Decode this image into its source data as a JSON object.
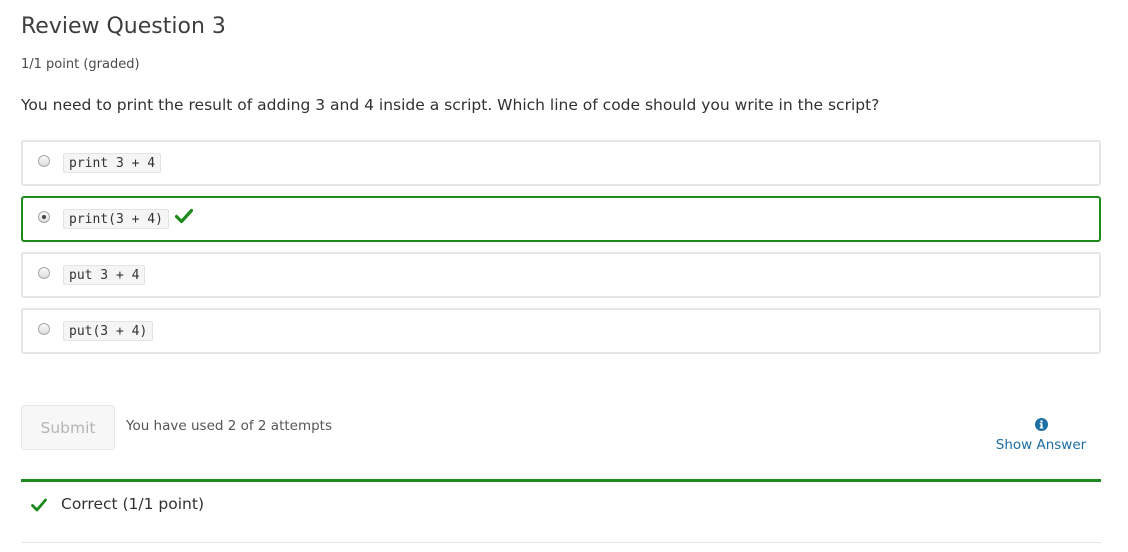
{
  "problem": {
    "title": "Review Question 3",
    "points": "1/1 point (graded)",
    "question": "You need to print the result of adding 3 and 4 inside a script. Which line of code should you write in the script?"
  },
  "options": [
    {
      "code": "print 3 + 4",
      "selected": false,
      "correct": false
    },
    {
      "code": "print(3 + 4)",
      "selected": true,
      "correct": true
    },
    {
      "code": "put 3 + 4",
      "selected": false,
      "correct": false
    },
    {
      "code": "put(3 + 4)",
      "selected": false,
      "correct": false
    }
  ],
  "actions": {
    "submit_label": "Submit",
    "attempts_text": "You have used 2 of 2 attempts",
    "show_answer_label": "Show Answer"
  },
  "feedback": {
    "text": "Correct (1/1 point)"
  },
  "colors": {
    "correct": "#1e8a1e",
    "link": "#1c6ea4"
  },
  "icons": {
    "check": "check-icon",
    "info": "info-icon"
  }
}
